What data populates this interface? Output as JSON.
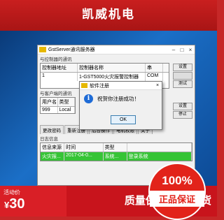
{
  "banner": {
    "title": "凯威机电"
  },
  "window": {
    "title": "GstServer通讯服务器",
    "controller_section": "与控制器的通讯",
    "controller_headers": [
      "控制器地址",
      "控制器名称",
      "串"
    ],
    "controller_rows": [
      [
        "1",
        "1-GST5000火灾报警控制器",
        "COM"
      ]
    ],
    "client_section": "与客户端的通讯",
    "client_headers": [
      "用户名",
      "类型"
    ],
    "client_rows": [
      [
        "999",
        "Local"
      ]
    ],
    "buttons": {
      "settings": "设置",
      "test": "测试",
      "settings2": "设置",
      "stop": "停止"
    },
    "tabs": [
      "更改密码",
      "重新注册",
      "后台操作",
      "电机权限",
      "关于"
    ],
    "log_section": "日志信息",
    "log_headers": [
      "信息来源",
      "时间",
      "类型"
    ],
    "log_rows": [
      [
        "火灾报...",
        "2017-04-0...",
        "系统...",
        "登录系统"
      ]
    ]
  },
  "dialog": {
    "title": "软件注册",
    "message": "祝贺你注册成功！",
    "ok_label": "OK"
  },
  "badge": {
    "percent": "100%",
    "label": "正品保证"
  },
  "promo": {
    "label": "活动价",
    "currency": "¥",
    "price": "30",
    "slogan": "质量保证 快速发货"
  }
}
